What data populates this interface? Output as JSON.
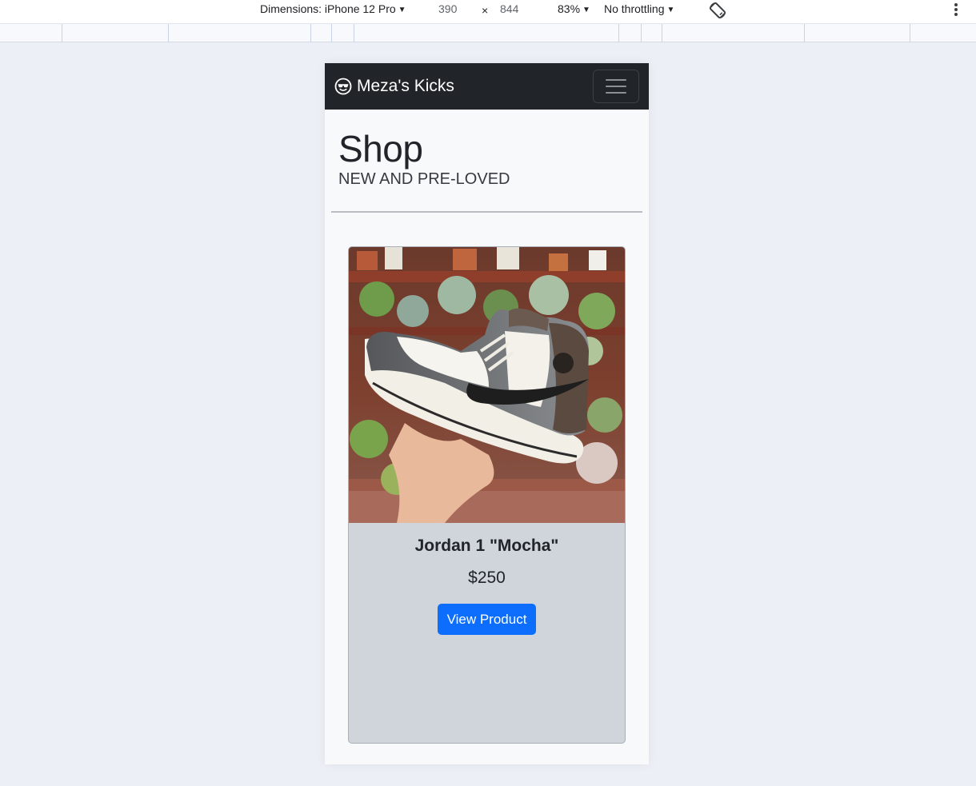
{
  "devtools": {
    "dimensions_label": "Dimensions: iPhone 12 Pro",
    "width": "390",
    "times": "×",
    "height": "844",
    "zoom": "83%",
    "throttling": "No throttling",
    "rotate_icon": "rotate-icon",
    "menu_icon": "more-vertical-icon"
  },
  "navbar": {
    "brand_icon": "cool-face-icon",
    "brand": "Meza's Kicks",
    "toggler_icon": "hamburger-icon"
  },
  "header": {
    "title": "Shop",
    "subtitle": "NEW AND PRE-LOVED"
  },
  "product": {
    "name": "Jordan 1 \"Mocha\"",
    "price": "$250",
    "button_label": "View Product"
  },
  "colors": {
    "navbar_bg": "#212529",
    "button_bg": "#0d6efd",
    "card_bg": "#d0d4db",
    "page_bg": "#f8f9fa"
  }
}
